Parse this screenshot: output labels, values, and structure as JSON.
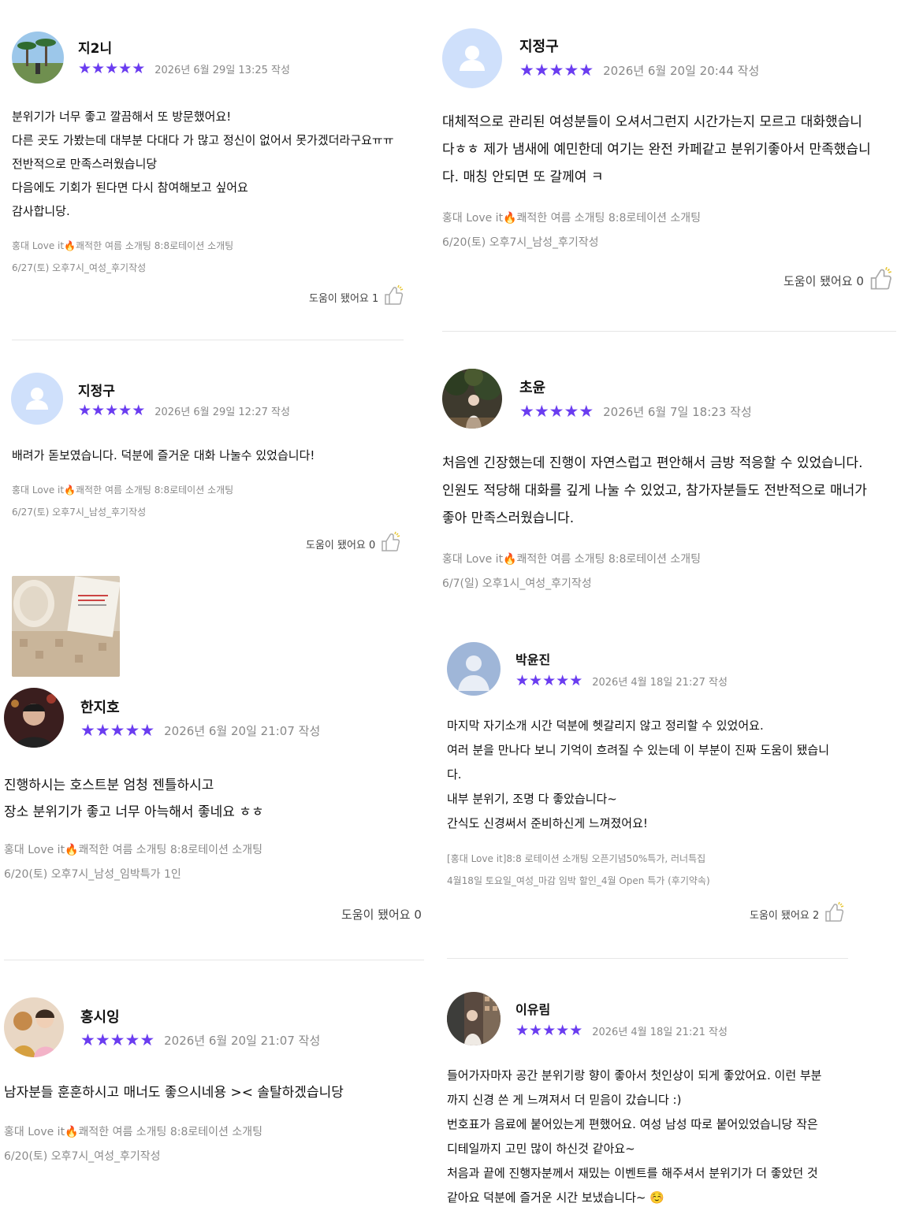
{
  "colors": {
    "star": "#6a3cf0",
    "muted": "#8a8a8a",
    "avatar_placeholder": "#cfe0fb"
  },
  "icons": {
    "star": "star-icon",
    "thumb": "thumbs-up-icon",
    "fire": "fire-emoji-icon",
    "user": "user-placeholder-icon"
  },
  "reviews": [
    {
      "name": "지2니",
      "rating": 5,
      "date": "2026년 6월 29일 13:25 작성",
      "lines": [
        "분위기가 너무 좋고 깔끔해서 또 방문했어요!",
        "다른 곳도 가봤는데 대부분 다대다 가 많고 정신이 없어서 못가겠더라구요ㅠㅠ",
        "전반적으로 만족스러웠습니당",
        "다음에도 기회가 된다면 다시 참여해보고 싶어요",
        "감사합니당."
      ],
      "event_prefix": "홍대 Love it",
      "event_suffix": "쾌적한 여름 소개팅 8:8로테이션  소개팅",
      "session": "6/27(토) 오후7시_여성_후기작성",
      "helpful": "도움이 됐어요 1"
    },
    {
      "name": "지정구",
      "rating": 5,
      "date": "2026년 6월 20일 20:44 작성",
      "lines": [
        "대체적으로 관리된 여성분들이 오셔서그런지 시간가는지 모르고 대화했습니",
        "다ㅎㅎ 제가 냄새에 예민한데 여기는 완전 카페같고 분위기좋아서 만족했습니",
        "다. 매칭 안되면 또 갈께여 ㅋ"
      ],
      "event_prefix": "홍대 Love it",
      "event_suffix": "쾌적한 여름 소개팅 8:8로테이션  소개팅",
      "session": "6/20(토) 오후7시_남성_후기작성",
      "helpful": "도움이 됐어요 0"
    },
    {
      "name": "지정구",
      "rating": 5,
      "date": "2026년 6월 29일 12:27 작성",
      "lines": [
        "배려가 돋보였습니다. 덕분에 즐거운 대화 나눌수 있었습니다!"
      ],
      "event_prefix": "홍대 Love it",
      "event_suffix": "쾌적한 여름 소개팅 8:8로테이션  소개팅",
      "session": "6/27(토) 오후7시_남성_후기작성",
      "helpful": "도움이 됐어요 0"
    },
    {
      "name": "초윤",
      "rating": 5,
      "date": "2026년 6월 7일 18:23 작성",
      "lines": [
        "처음엔 긴장했는데 진행이 자연스럽고 편안해서 금방 적응할 수 있었습니다.",
        "인원도 적당해 대화를 깊게 나눌 수 있었고, 참가자분들도 전반적으로 매너가",
        "좋아 만족스러웠습니다."
      ],
      "event_prefix": "홍대 Love it",
      "event_suffix": "쾌적한 여름 소개팅 8:8로테이션  소개팅",
      "session": "6/7(일) 오후1시_여성_후기작성",
      "helpful": ""
    },
    {
      "name": "한지호",
      "rating": 5,
      "date": "2026년 6월 20일 21:07 작성",
      "lines": [
        "진행하시는 호스트분 엄청 젠틀하시고",
        "장소 분위기가 좋고 너무 아늑해서 좋네요 ㅎㅎ"
      ],
      "event_prefix": "홍대 Love it",
      "event_suffix": "쾌적한 여름 소개팅 8:8로테이션  소개팅",
      "session": "6/20(토) 오후7시_남성_임박특가 1인",
      "helpful": "도움이 됐어요 0"
    },
    {
      "name": "박윤진",
      "rating": 5,
      "date": "2026년 4월 18일 21:27 작성",
      "lines": [
        "마지막 자기소개 시간 덕분에 헷갈리지 않고 정리할 수 있었어요.",
        "여러 분을 만나다 보니 기억이 흐려질 수 있는데 이 부분이 진짜 도움이 됐습니",
        "다.",
        "내부 분위기, 조명 다 좋았습니다~",
        "간식도 신경써서 준비하신게 느껴졌어요!"
      ],
      "event_full": "[홍대 Love it]8:8 로테이션 소개팅 오픈기념50%특가, 러너특집",
      "session": "4월18일 토요일_여성_마감 임박 할인_4월 Open 특가 (후기약속)",
      "helpful": "도움이 됐어요 2"
    },
    {
      "name": "홍시잉",
      "rating": 5,
      "date": "2026년 6월 20일 21:07 작성",
      "lines": [
        "남자분들 훈훈하시고 매너도 좋으시네용 >< 솔탈하겠습니당"
      ],
      "event_prefix": "홍대 Love it",
      "event_suffix": "쾌적한 여름 소개팅 8:8로테이션  소개팅",
      "session": "6/20(토) 오후7시_여성_후기작성",
      "helpful": ""
    },
    {
      "name": "이유림",
      "rating": 5,
      "date": "2026년 4월 18일 21:21 작성",
      "lines": [
        "들어가자마자 공간 분위기랑 향이 좋아서 첫인상이 되게 좋았어요. 이런 부분",
        "까지 신경 쓴 게 느껴져서 더 믿음이 갔습니다 :)",
        "번호표가 음료에 붙어있는게 편했어요. 여성 남성 따로 붙어있었습니당 작은",
        "디테일까지 고민 많이 하신것 같아요~",
        "처음과 끝에 진행자분께서 재밌는 이벤트를 해주셔서 분위기가 더 좋았던 것",
        "같아요 덕분에 즐거운 시간 보냈습니다~ ☺️"
      ],
      "helpful": ""
    }
  ]
}
